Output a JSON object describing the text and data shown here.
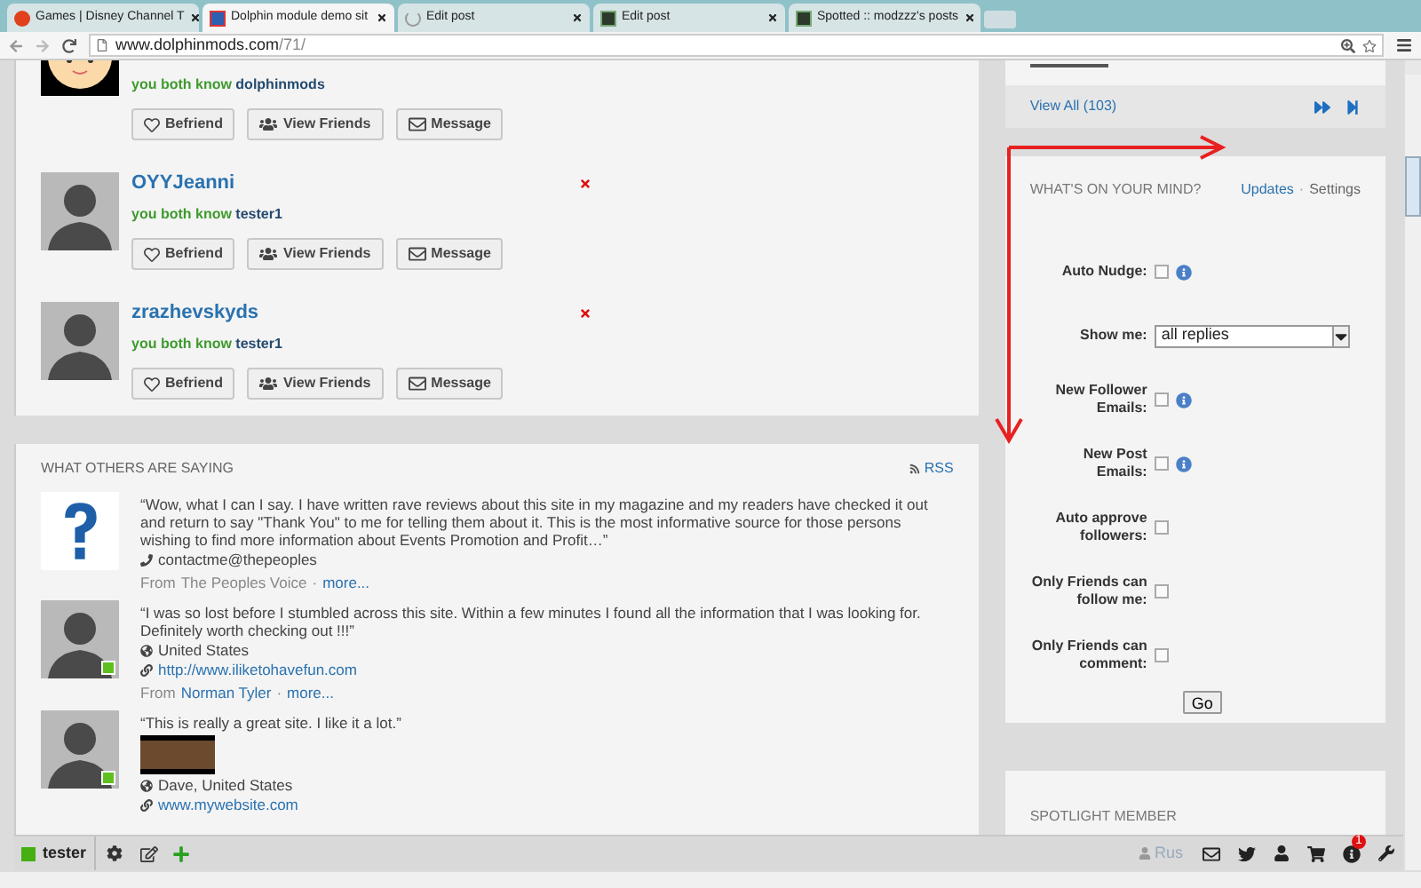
{
  "browser": {
    "tabs": [
      {
        "title": "Games | Disney Channel T",
        "selected": false,
        "kind": "disney"
      },
      {
        "title": "Dolphin module demo sit",
        "selected": true,
        "kind": "dolphin"
      },
      {
        "title": "Edit post",
        "selected": false,
        "kind": "loading"
      },
      {
        "title": "Edit post",
        "selected": false,
        "kind": "dark"
      },
      {
        "title": "Spotted :: modzzz's posts",
        "selected": false,
        "kind": "dark"
      }
    ],
    "address": {
      "host": "www.dolphinmods.com",
      "path": "/71/"
    }
  },
  "friends": [
    {
      "avatar": {
        "kind": "cartoon"
      },
      "mutual_prefix": "you both know",
      "mutual_name": "dolphinmods",
      "removable": false,
      "actions": [
        {
          "label": "Befriend",
          "kind": "heart"
        },
        {
          "label": "View Friends",
          "kind": "users"
        },
        {
          "label": "Message",
          "kind": "mail"
        }
      ]
    },
    {
      "avatar": {
        "kind": "silhouette"
      },
      "name": "OYYJeanni",
      "mutual_prefix": "you both know",
      "mutual_name": "tester1",
      "removable": true,
      "actions": [
        {
          "label": "Befriend",
          "kind": "heart"
        },
        {
          "label": "View Friends",
          "kind": "users"
        },
        {
          "label": "Message",
          "kind": "mail"
        }
      ]
    },
    {
      "avatar": {
        "kind": "silhouette"
      },
      "name": "zrazhevskyds",
      "mutual_prefix": "you both know",
      "mutual_name": "tester1",
      "removable": true,
      "actions": [
        {
          "label": "Befriend",
          "kind": "heart"
        },
        {
          "label": "View Friends",
          "kind": "users"
        },
        {
          "label": "Message",
          "kind": "mail"
        }
      ]
    }
  ],
  "testimonials": {
    "title": "WHAT OTHERS ARE SAYING",
    "rss": "RSS",
    "items": [
      {
        "avatar": {
          "kind": "question"
        },
        "online": false,
        "quote": "“Wow, what I can I say. I have written rave reviews about this site in my magazine and my readers have checked it out and return to say \"Thank You\" to me for telling them about it. This is the most informative source for those persons wishing to find more information about Events Promotion and Profit…”",
        "details": [
          {
            "kind": "phone",
            "text": "contactme@thepeoples"
          }
        ],
        "from": "From",
        "author": "The Peoples Voice",
        "author_link": false,
        "separator": "·",
        "more": "more..."
      },
      {
        "avatar": {
          "kind": "silhouette"
        },
        "online": true,
        "quote": "“I was so lost before I stumbled across this site. Within a few minutes I found all the information that I was looking for. Definitely worth checking out !!!”",
        "details": [
          {
            "kind": "globe",
            "text": "United States"
          },
          {
            "kind": "link",
            "text": "http://www.iliketohavefun.com"
          }
        ],
        "from": "From",
        "author": "Norman Tyler",
        "author_link": true,
        "separator": "·",
        "more": "more..."
      },
      {
        "avatar": {
          "kind": "silhouette"
        },
        "online": true,
        "quote": "“This is really a great site. I like it a lot.”",
        "media": {
          "kind": "video"
        },
        "details": [
          {
            "kind": "globe",
            "text": "Dave, United States"
          },
          {
            "kind": "link",
            "text": "www.mywebsite.com"
          }
        ]
      }
    ]
  },
  "sidebar": {
    "view_all": "View All (103)",
    "mind": {
      "title": "WHAT'S ON YOUR MIND?",
      "links": [
        "Updates",
        "Settings"
      ],
      "separator": "·",
      "fields": [
        {
          "kind": "checkbox",
          "label": "Auto Nudge:",
          "checked": false,
          "info": true
        },
        {
          "kind": "select",
          "label": "Show me:",
          "value": "all replies"
        },
        {
          "kind": "checkbox",
          "label": "New Follower Emails:",
          "checked": false,
          "info": true
        },
        {
          "kind": "checkbox",
          "label": "New Post Emails:",
          "checked": false,
          "info": true
        },
        {
          "kind": "checkbox",
          "label": "Auto approve followers:",
          "checked": false,
          "info": false
        },
        {
          "kind": "checkbox",
          "label": "Only Friends can follow me:",
          "checked": false,
          "info": false
        },
        {
          "kind": "checkbox",
          "label": "Only Friends can comment:",
          "checked": false,
          "info": false
        }
      ],
      "submit": "Go"
    },
    "spotlight": {
      "title": "SPOTLIGHT MEMBER",
      "member": "Rus"
    }
  },
  "toolbar": {
    "user": "tester",
    "online": true,
    "badge": "1"
  }
}
